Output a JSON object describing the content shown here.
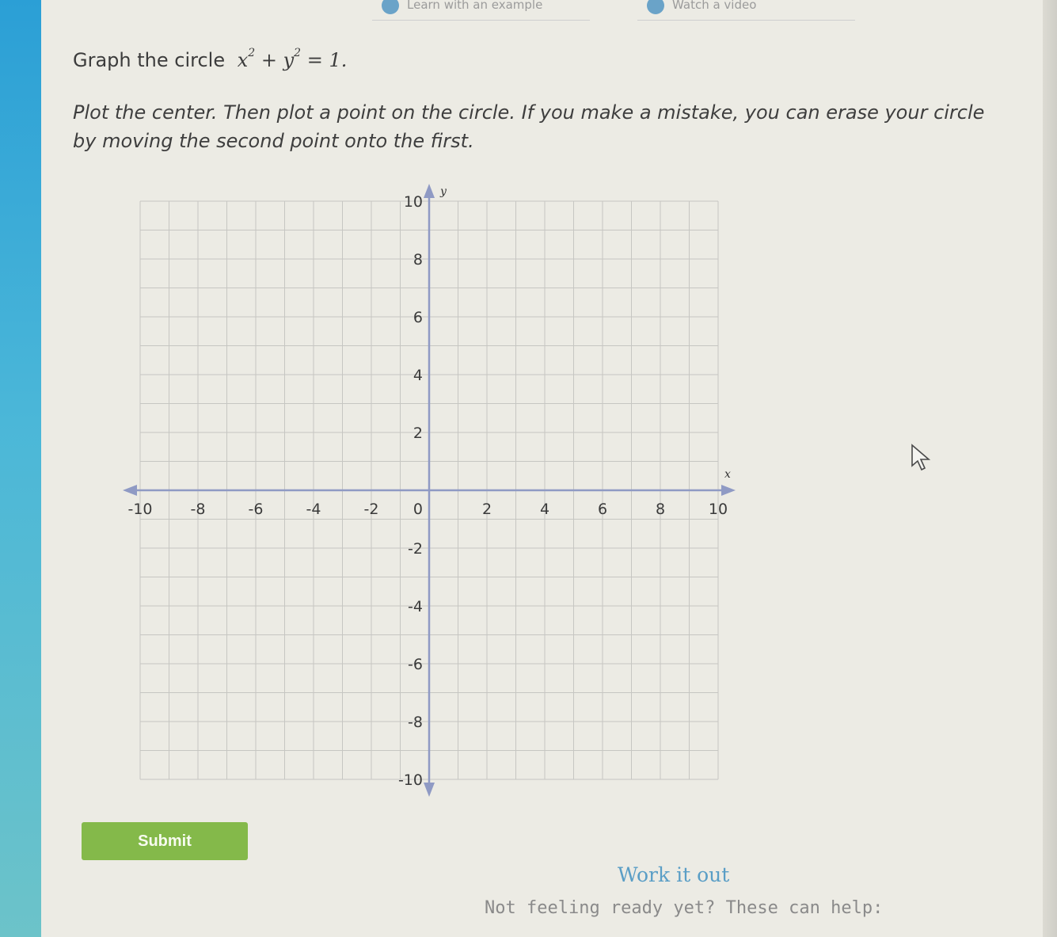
{
  "top_toolbar": {
    "items": [
      {
        "label": "Learn with an example",
        "icon": "lightbulb-icon"
      },
      {
        "label": "Watch a video",
        "icon": "play-icon"
      }
    ]
  },
  "question": {
    "prefix": "Graph the circle",
    "equation": {
      "x": "x",
      "y": "y",
      "exp": "2",
      "plus": "+",
      "equals": "= 1."
    }
  },
  "instructions": "Plot the center. Then plot a point on the circle. If you make a mistake, you can erase your circle by moving the second point onto the first.",
  "graph": {
    "x_axis_label": "x",
    "y_axis_label": "y",
    "x_ticks": [
      "-10",
      "-8",
      "-6",
      "-4",
      "-2",
      "0",
      "2",
      "4",
      "6",
      "8",
      "10"
    ],
    "y_ticks": [
      "10",
      "8",
      "6",
      "4",
      "2",
      "-2",
      "-4",
      "-6",
      "-8",
      "-10"
    ],
    "x_range": [
      -10,
      10
    ],
    "y_range": [
      -10,
      10
    ],
    "grid": true,
    "grid_step": 1,
    "axis_color": "#8f9ac4",
    "grid_color": "#c6c6c2"
  },
  "submit": {
    "label": "Submit",
    "color": "#84b94a"
  },
  "work_it_out": "Work it out",
  "help_text": "Not feeling ready yet? These can help:",
  "colors": {
    "accent_blue": "#2b9fd6",
    "link": "#5a9ec6"
  }
}
